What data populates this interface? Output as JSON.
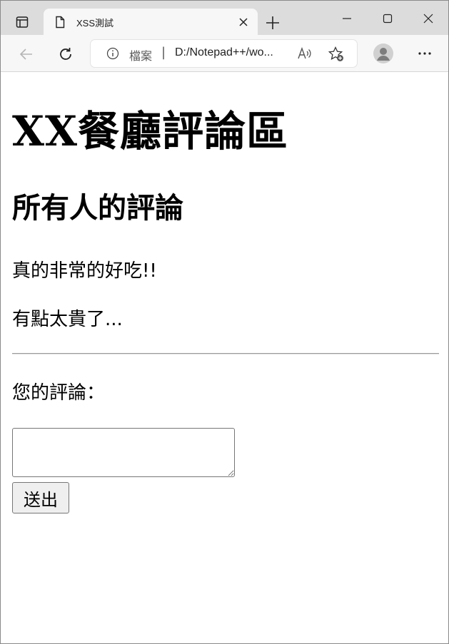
{
  "browser": {
    "tab_title": "XSS測試",
    "address": {
      "scheme_label": "檔案",
      "separator": "|",
      "url_text": "D:/Notepad++/wo..."
    },
    "icons": {
      "tab_actions": "tab-actions-icon",
      "tab_page": "page-icon",
      "tab_close": "close-icon",
      "new_tab": "plus-icon",
      "minimize": "minimize-icon",
      "maximize": "maximize-icon",
      "window_close": "close-icon",
      "back": "back-arrow-icon",
      "reload": "reload-icon",
      "info": "info-icon",
      "read_aloud": "read-aloud-icon",
      "favorite": "favorite-add-icon",
      "profile": "profile-avatar-icon",
      "menu": "more-icon"
    }
  },
  "page": {
    "heading": "XX餐廳評論區",
    "subheading": "所有人的評論",
    "comments": [
      "真的非常的好吃!!",
      "有點太貴了..."
    ],
    "form": {
      "label": "您的評論：",
      "textarea_value": "",
      "submit_label": "送出"
    }
  }
}
